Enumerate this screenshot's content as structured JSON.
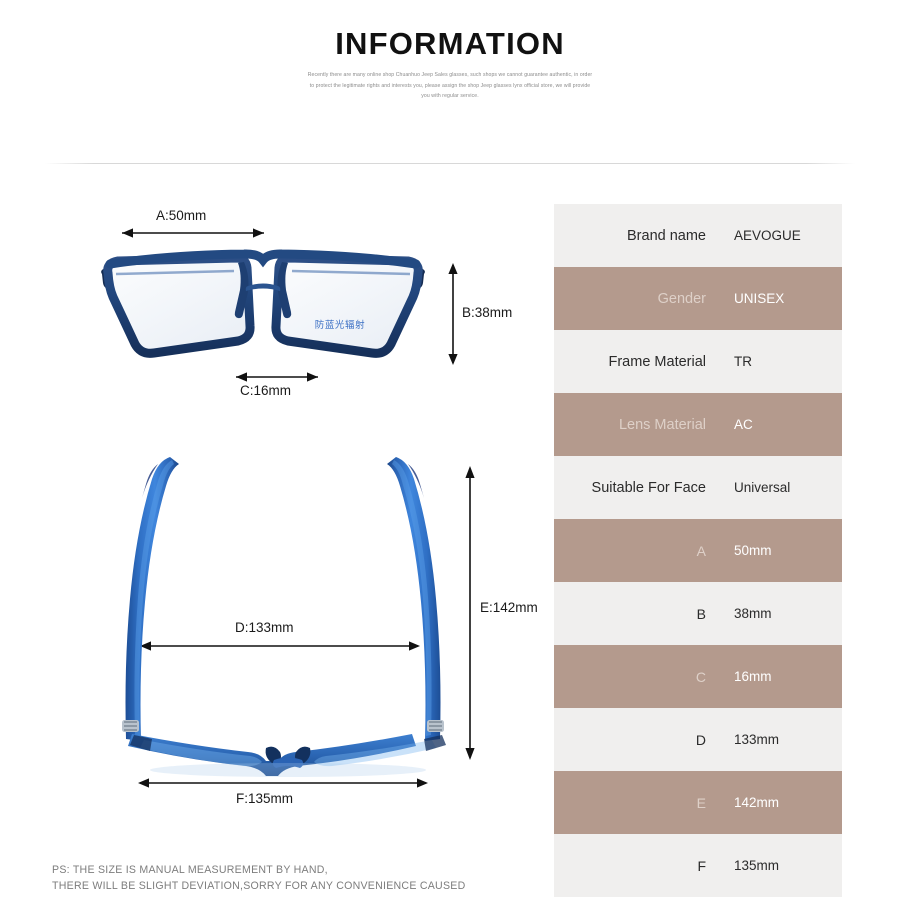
{
  "header": {
    "title": "INFORMATION",
    "intro_lines": [
      "Recently there are many online shop Chuanhuo Jeep Sales glasses, such shops we cannot guarantee authentic, in order",
      "to protect the legitimate rights and interests you, please assign the shop Jeep glasses lynx official store, we will provide",
      "you with regular service."
    ]
  },
  "front_view": {
    "lens_print": "防蓝光辐射",
    "dimensions": {
      "a": "A:50mm",
      "b": "B:38mm",
      "c": "C:16mm"
    }
  },
  "top_view": {
    "dimensions": {
      "d": "D:133mm",
      "e": "E:142mm",
      "f": "F:135mm"
    }
  },
  "spec_table": {
    "rows": [
      {
        "key": "Brand name",
        "value": "AEVOGUE",
        "style": "light"
      },
      {
        "key": "Gender",
        "value": "UNISEX",
        "style": "dark"
      },
      {
        "key": "Frame Material",
        "value": "TR",
        "style": "light"
      },
      {
        "key": "Lens Material",
        "value": "AC",
        "style": "dark"
      },
      {
        "key": "Suitable For Face",
        "value": "Universal",
        "style": "light"
      },
      {
        "key": "A",
        "value": "50mm",
        "style": "dark"
      },
      {
        "key": "B",
        "value": "38mm",
        "style": "light"
      },
      {
        "key": "C",
        "value": "16mm",
        "style": "dark"
      },
      {
        "key": "D",
        "value": "133mm",
        "style": "light"
      },
      {
        "key": "E",
        "value": "142mm",
        "style": "dark"
      },
      {
        "key": "F",
        "value": "135mm",
        "style": "light"
      }
    ]
  },
  "footer": {
    "ps_lines": [
      "PS: THE SIZE IS MANUAL MEASUREMENT BY HAND,",
      "THERE WILL BE SLIGHT DEVIATION,SORRY FOR ANY CONVENIENCE CAUSED"
    ]
  },
  "colors": {
    "accent_dark_row": "#b49a8d",
    "light_row": "#f0efee",
    "frame_blue": "#2f5d9e",
    "title_text": "#111111"
  }
}
